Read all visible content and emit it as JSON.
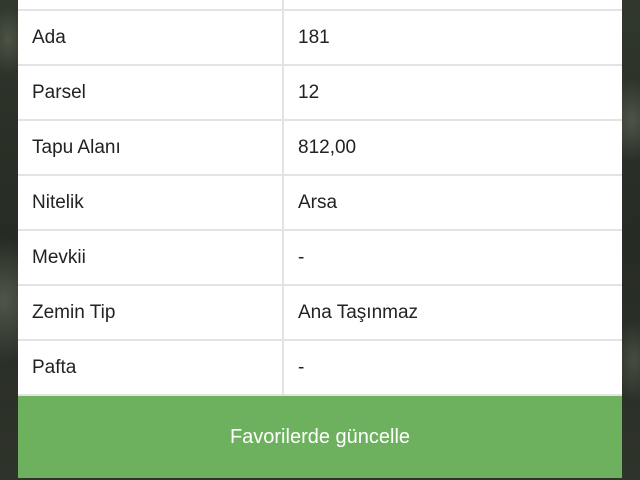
{
  "details": {
    "rows": [
      {
        "label": "",
        "value": ""
      },
      {
        "label": "Ada",
        "value": "181"
      },
      {
        "label": "Parsel",
        "value": "12"
      },
      {
        "label": "Tapu Alanı",
        "value": "812,00"
      },
      {
        "label": "Nitelik",
        "value": "Arsa"
      },
      {
        "label": "Mevkii",
        "value": "-"
      },
      {
        "label": "Zemin Tip",
        "value": "Ana Taşınmaz"
      },
      {
        "label": "Pafta",
        "value": "-"
      }
    ]
  },
  "action": {
    "label": "Favorilerde güncelle"
  },
  "colors": {
    "button": "#6db15f",
    "divider": "#e3e3e3"
  }
}
